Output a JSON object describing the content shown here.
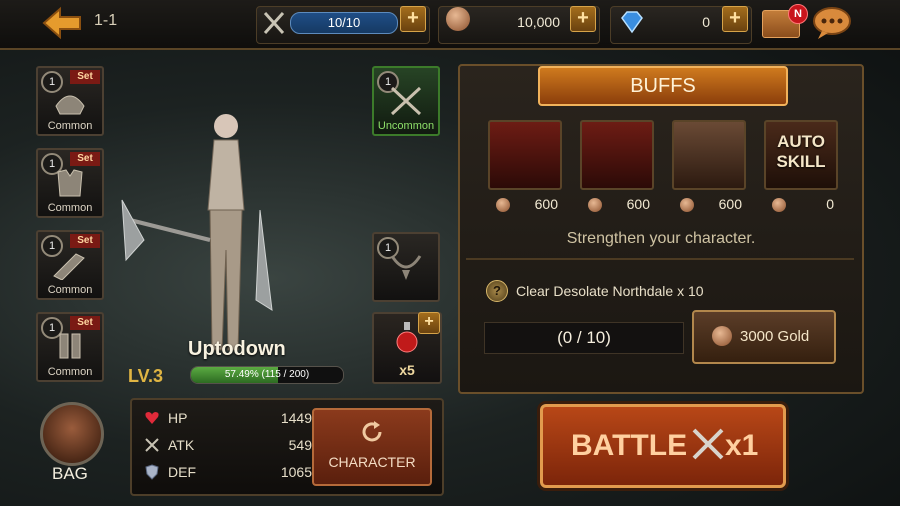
{
  "topbar": {
    "stage": "1-1",
    "energy": "10/10",
    "gold": "10,000",
    "gems": "0",
    "mail_badge": "N"
  },
  "equipment": [
    {
      "level": "1",
      "set": "Set",
      "rarity": "Common"
    },
    {
      "level": "1",
      "set": "Set",
      "rarity": "Common"
    },
    {
      "level": "1",
      "set": "Set",
      "rarity": "Common"
    },
    {
      "level": "1",
      "set": "Set",
      "rarity": "Common"
    },
    {
      "level": "1",
      "rarity": "Uncommon"
    },
    {
      "level": "1"
    }
  ],
  "hero": {
    "name": "Uptodown",
    "level": "LV.3",
    "xp_text": "57.49% (115 / 200)",
    "xp_fraction": 0.5749
  },
  "potion": {
    "count": "x5"
  },
  "bag": {
    "label": "BAG"
  },
  "stats": [
    {
      "label": "HP",
      "value": "1449",
      "icon": "heart-icon"
    },
    {
      "label": "ATK",
      "value": "549",
      "icon": "swords-icon"
    },
    {
      "label": "DEF",
      "value": "1065",
      "icon": "shield-icon"
    }
  ],
  "character_button": {
    "label": "CHARACTER"
  },
  "buffs": {
    "title": "BUFFS",
    "items": [
      {
        "cost": "600",
        "icon": "gauntlet-buff-icon"
      },
      {
        "cost": "600",
        "icon": "armor-buff-icon"
      },
      {
        "cost": "600",
        "icon": "muscle-buff-icon"
      },
      {
        "cost": "0",
        "icon": "auto-skill-buff-icon",
        "label": "AUTO SKILL"
      }
    ],
    "subtitle": "Strengthen your character."
  },
  "quest": {
    "text": "Clear Desolate Northdale x 10",
    "progress": "(0 / 10)",
    "reward": "3000 Gold"
  },
  "battle": {
    "label": "BATTLE",
    "multiplier": "x1"
  },
  "colors": {
    "accent": "#cf7a1e",
    "uncommon": "#3c7b2a",
    "xp_fill": "#5bab42",
    "battle": "#b84717"
  }
}
